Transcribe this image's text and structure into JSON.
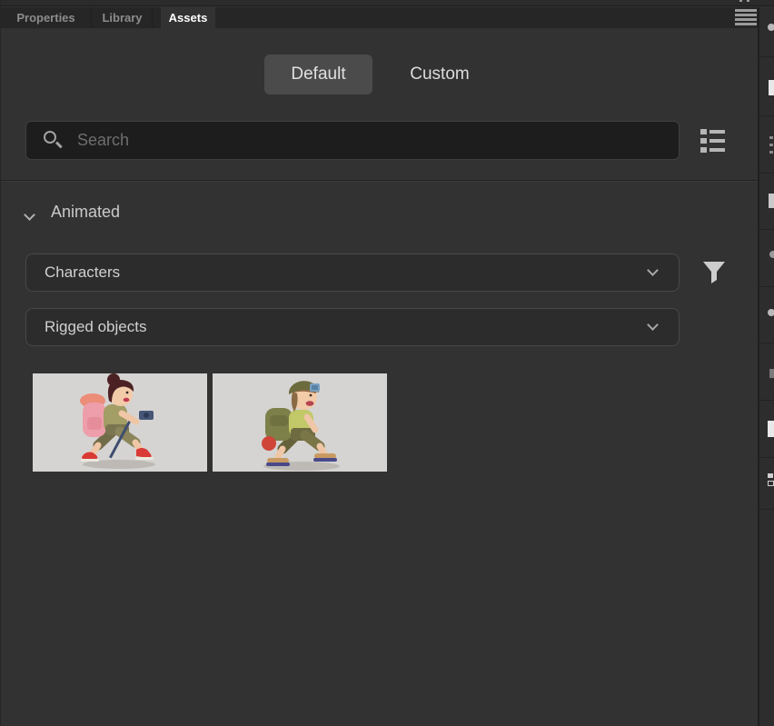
{
  "header": {
    "tabs": [
      {
        "label": "Properties",
        "active": false
      },
      {
        "label": "Library",
        "active": false
      },
      {
        "label": "Assets",
        "active": true
      }
    ]
  },
  "mode_toggle": {
    "default_label": "Default",
    "custom_label": "Custom",
    "selected": "Default"
  },
  "search": {
    "placeholder": "Search",
    "value": ""
  },
  "section_animated": {
    "title": "Animated",
    "expanded": true
  },
  "dropdowns": [
    {
      "value": "Characters"
    },
    {
      "value": "Rigged objects"
    }
  ],
  "assets": [
    {
      "name": "hiking-girl-walk",
      "kind": "rigged-character-thumbnail"
    },
    {
      "name": "hiking-boy-walk",
      "kind": "rigged-character-thumbnail"
    }
  ],
  "colors": {
    "panel_bg": "#323232",
    "tabbar_bg": "#262626",
    "selected_toggle_bg": "#4b4b4b",
    "search_bg": "#1d1d1d",
    "dropdown_bg": "#2c2c2c",
    "thumbnail_bg": "#d5d4d2",
    "active_tab_text": "#ffffff",
    "inactive_tab_text": "#8c8c8c"
  }
}
